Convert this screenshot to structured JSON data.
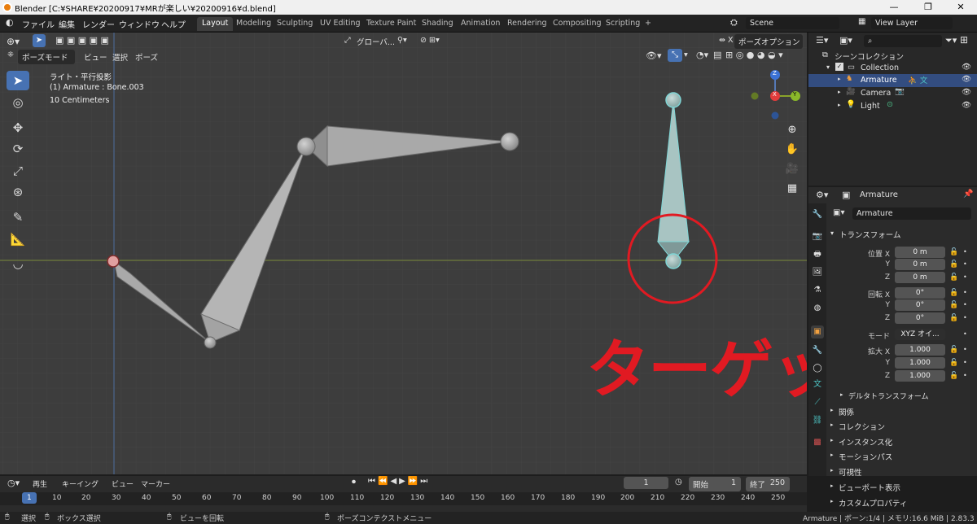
{
  "window": {
    "title": "Blender [C:¥SHARE¥20200917¥MRが楽しい¥20200916¥d.blend]",
    "controls": [
      "—",
      "❐",
      "✕"
    ]
  },
  "menubar": {
    "menus": [
      "ファイル",
      "編集",
      "レンダー",
      "ウィンドウ",
      "ヘルプ"
    ],
    "workspaces": [
      "Layout",
      "Modeling",
      "Sculpting",
      "UV Editing",
      "Texture Paint",
      "Shading",
      "Animation",
      "Rendering",
      "Compositing",
      "Scripting"
    ],
    "active_workspace": "Layout",
    "add_tab": "+",
    "scene": "Scene",
    "view_layer": "View Layer"
  },
  "viewport": {
    "mode": "ポーズモード",
    "header_menus": [
      "ビュー",
      "選択",
      "ポーズ"
    ],
    "transform_orientation": "グローバ...",
    "pose_options": "ポーズオプション",
    "info_lines": [
      "ライト・平行投影",
      "(1) Armature : Bone.003",
      "10 Centimeters"
    ],
    "annotation": "ターゲット",
    "annotation_color": "#e11a22",
    "gizmo_axes": {
      "x": "X",
      "y": "Y",
      "z": "Z"
    },
    "tools": [
      "select-box-icon",
      "cursor-icon",
      "move-icon",
      "rotate-icon",
      "scale-icon",
      "transform-icon",
      "annotate-icon",
      "measure-icon",
      "relax-icon"
    ]
  },
  "outliner": {
    "title": "シーンコレクション",
    "items": [
      {
        "label": "Collection"
      },
      {
        "label": "Armature"
      },
      {
        "label": "Camera"
      },
      {
        "label": "Light"
      }
    ]
  },
  "properties": {
    "object_name": "Armature",
    "object_field": "Armature",
    "transform_title": "トランスフォーム",
    "location_label": "位置 X",
    "rotation_label": "回転 X",
    "mode_label": "モード",
    "scale_label": "拡大 X",
    "axis_y": "Y",
    "axis_z": "Z",
    "location": [
      "0 m",
      "0 m",
      "0 m"
    ],
    "rotation": [
      "0°",
      "0°",
      "0°"
    ],
    "rotation_mode": "XYZ オイ...",
    "scale": [
      "1.000",
      "1.000",
      "1.000"
    ],
    "delta_title": "デルタトランスフォーム",
    "sections": [
      "関係",
      "コレクション",
      "インスタンス化",
      "モーションパス",
      "可視性",
      "ビューポート表示",
      "カスタムプロパティ"
    ]
  },
  "timeline": {
    "menus": [
      "再生",
      "キーイング",
      "ビュー",
      "マーカー"
    ],
    "current_frame": "1",
    "start_label": "開始",
    "start": "1",
    "end_label": "終了",
    "end": "250",
    "ruler": [
      "1",
      "10",
      "20",
      "30",
      "40",
      "50",
      "60",
      "70",
      "80",
      "90",
      "100",
      "110",
      "120",
      "130",
      "140",
      "150",
      "160",
      "170",
      "180",
      "190",
      "200",
      "210",
      "220",
      "230",
      "240",
      "250"
    ]
  },
  "statusbar": {
    "select": "選択",
    "box_select": "ボックス選択",
    "rotate_view": "ビューを回転",
    "context_menu": "ポーズコンテクストメニュー",
    "info": "Armature | ボーン:1/4 | メモリ:16.6 MiB | 2.83.3"
  }
}
